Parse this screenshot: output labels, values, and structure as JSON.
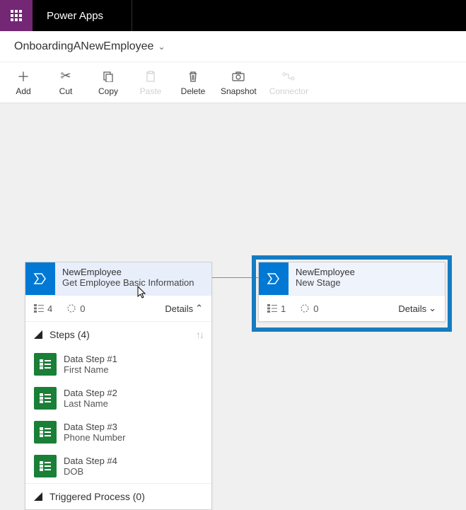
{
  "app_title": "Power Apps",
  "breadcrumb": "OnboardingANewEmployee",
  "toolbar": {
    "add": "Add",
    "cut": "Cut",
    "copy": "Copy",
    "paste": "Paste",
    "delete": "Delete",
    "snapshot": "Snapshot",
    "connector": "Connector"
  },
  "stage1": {
    "entity": "NewEmployee",
    "name": "Get Employee Basic Information",
    "step_count": "4",
    "wait_count": "0",
    "details": "Details",
    "steps_header": "Steps (4)",
    "steps": [
      {
        "title": "Data Step #1",
        "sub": "First Name"
      },
      {
        "title": "Data Step #2",
        "sub": "Last Name"
      },
      {
        "title": "Data Step #3",
        "sub": "Phone Number"
      },
      {
        "title": "Data Step #4",
        "sub": "DOB"
      }
    ],
    "triggered": "Triggered Process (0)"
  },
  "stage2": {
    "entity": "NewEmployee",
    "name": "New Stage",
    "step_count": "1",
    "wait_count": "0",
    "details": "Details"
  }
}
